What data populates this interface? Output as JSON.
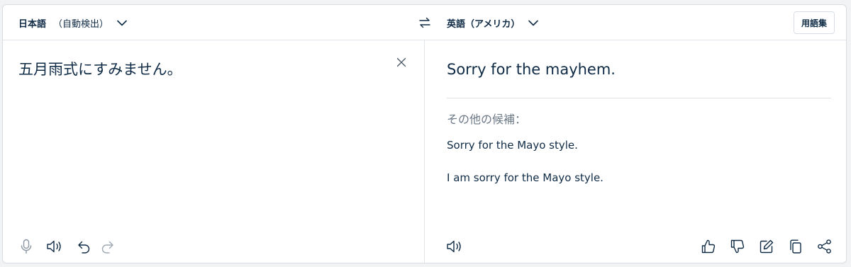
{
  "source": {
    "language_label": "日本語",
    "detect_label": "（自動検出）",
    "text": "五月雨式にすみません。"
  },
  "target": {
    "language_label": "英語（アメリカ）",
    "translation": "Sorry for the mayhem.",
    "alternatives_label": "その他の候補：",
    "alternatives": [
      "Sorry for the Mayo style.",
      "I am sorry for the Mayo style."
    ]
  },
  "toolbar": {
    "glossary_label": "用語集"
  },
  "icons": {
    "source_toolbar": [
      "microphone-icon",
      "speaker-icon",
      "undo-icon",
      "redo-icon"
    ],
    "target_toolbar": [
      "speaker-icon",
      "thumbs-up-icon",
      "thumbs-down-icon",
      "edit-icon",
      "copy-icon",
      "share-icon"
    ]
  },
  "colors": {
    "text": "#0f2b46",
    "muted": "#6b7886",
    "border": "#d8dde3",
    "background": "#f1f3f5"
  }
}
